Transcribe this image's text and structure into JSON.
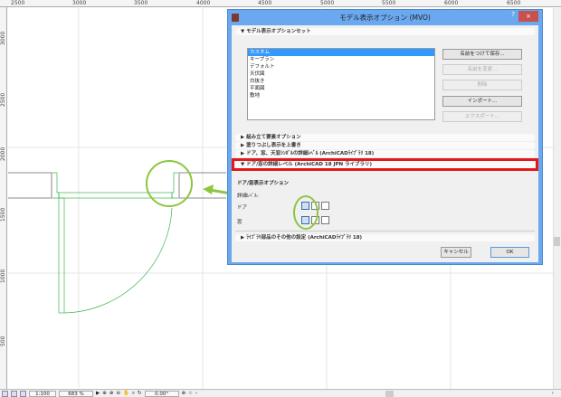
{
  "ruler": {
    "horizontal": [
      "2500",
      "3000",
      "3500",
      "4000",
      "4500",
      "5000",
      "5500",
      "6000",
      "6500"
    ],
    "vertical": [
      "3000",
      "2500",
      "2000",
      "1500",
      "1000",
      "500"
    ]
  },
  "dialog": {
    "title": "モデル表示オプション (MVO)",
    "help": "?",
    "close": "×",
    "sections": {
      "set": "モデル表示オプションセット",
      "assembly": "組み立て要素オプション",
      "fill": "塗りつぶし表示を上書き",
      "symbols": "ドア、窓、天窓ｼﾝﾎﾞﾙの詳細ﾚﾍﾞﾙ (ArchiCADﾗｲﾌﾞﾗﾘ 18)",
      "doorwin": "ドア/窓の詳細レベル (ArchiCAD 18 JPN ライブラリ)",
      "other": "ﾗｲﾌﾞﾗﾘ部品のその他の設定 (ArchiCADﾗｲﾌﾞﾗﾘ 18)"
    },
    "list": [
      {
        "label": "カスタム",
        "selected": true
      },
      {
        "label": "キープラン"
      },
      {
        "label": "デフォルト"
      },
      {
        "label": "天伏図"
      },
      {
        "label": "白抜き"
      },
      {
        "label": "平面図"
      },
      {
        "label": "敷地"
      }
    ],
    "buttons": {
      "save": "名前をつけて保存...",
      "rename": "名前を変更...",
      "delete": "削除",
      "import": "インポート...",
      "export": "エクスポート...",
      "cancel": "キャンセル",
      "ok": "OK"
    },
    "doorwin_options": {
      "heading": "ドア/窓表示オプション",
      "detail_label": "詳細ﾚﾍﾞﾙ:",
      "door": "ドア",
      "window": "窓",
      "selected_level": 1
    }
  },
  "status": {
    "scale": "1:100",
    "zoom": "683 %",
    "angle": "0.00°"
  },
  "colors": {
    "highlight": "#e0191b",
    "callout": "#8dc63f",
    "door_lines": "#3cb54a",
    "titlebar": "#6aa8f0"
  }
}
